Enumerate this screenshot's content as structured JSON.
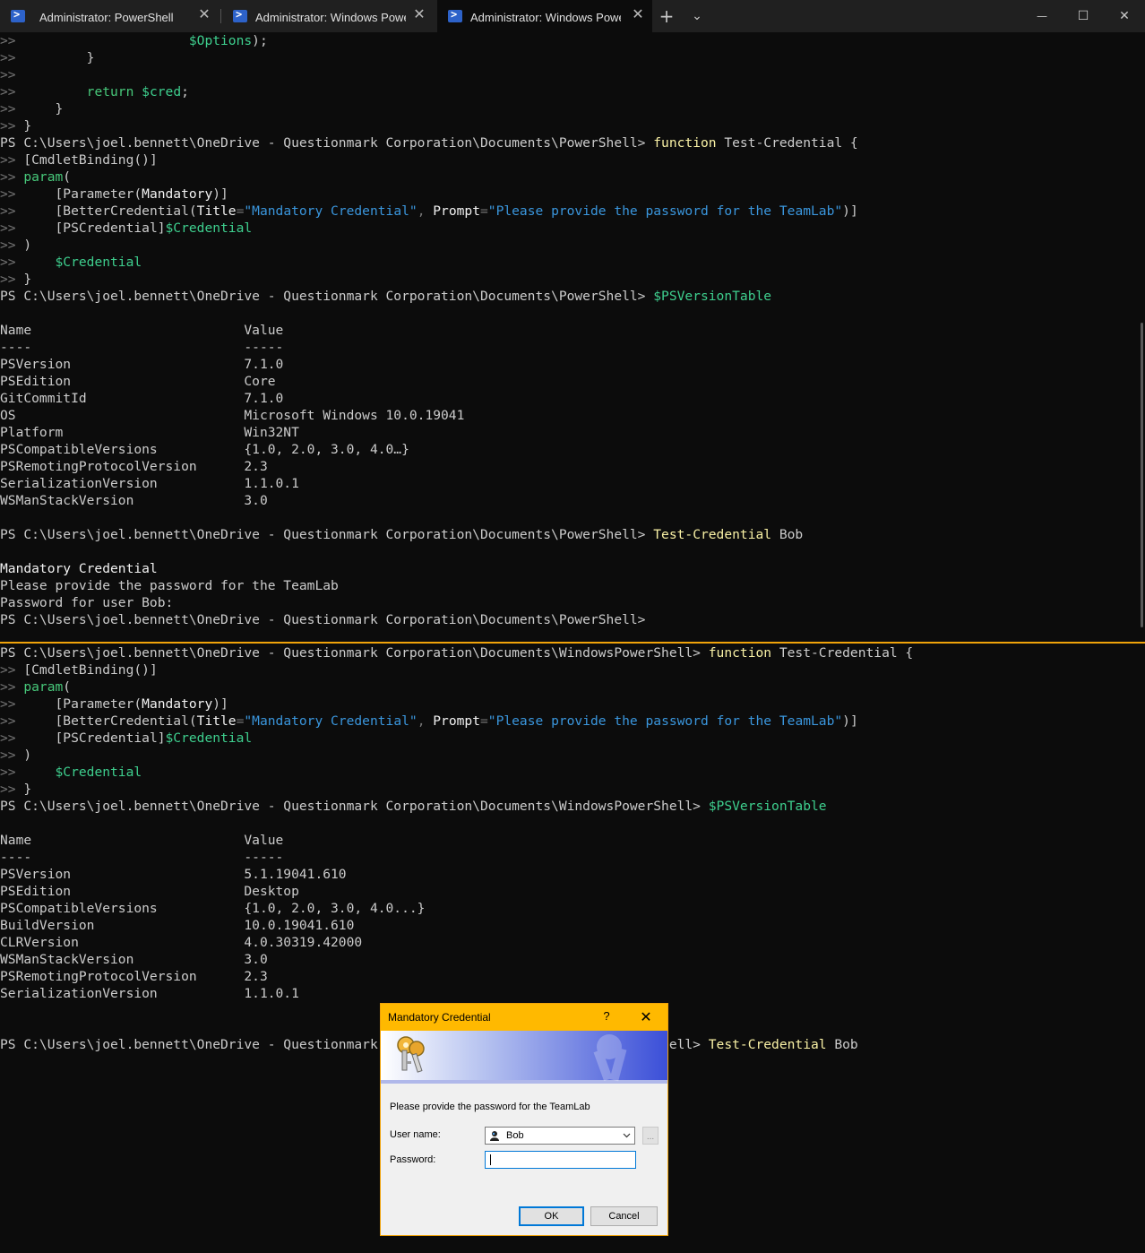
{
  "window": {
    "tabs": [
      {
        "label": "Administrator: PowerShell",
        "active": false
      },
      {
        "label": "Administrator: Windows PowerShell",
        "active": false
      },
      {
        "label": "Administrator: Windows PowerShell",
        "active": true
      }
    ],
    "new_tab_glyph": "+",
    "dropdown_glyph": "⌄",
    "minimize_glyph": "—",
    "maximize_glyph": "☐",
    "close_glyph": "✕",
    "tab_close_glyph": "✕"
  },
  "pane_top": {
    "lines": [
      [
        [
          "c-gry",
          ">> "
        ],
        [
          "c-def",
          "                     "
        ],
        [
          "c-var",
          "$Options"
        ],
        [
          "c-def",
          ");"
        ]
      ],
      [
        [
          "c-gry",
          ">> "
        ],
        [
          "c-def",
          "        }"
        ]
      ],
      [
        [
          "c-gry",
          ">>"
        ]
      ],
      [
        [
          "c-gry",
          ">> "
        ],
        [
          "c-def",
          "        "
        ],
        [
          "c-kw",
          "return"
        ],
        [
          "c-def",
          " "
        ],
        [
          "c-var",
          "$cred"
        ],
        [
          "c-def",
          ";"
        ]
      ],
      [
        [
          "c-gry",
          ">> "
        ],
        [
          "c-def",
          "    }"
        ]
      ],
      [
        [
          "c-gry",
          ">> "
        ],
        [
          "c-def",
          "}"
        ]
      ],
      [
        [
          "c-def",
          "PS C:\\Users\\joel.bennett\\OneDrive - Questionmark Corporation\\Documents\\PowerShell> "
        ],
        [
          "c-cmd",
          "function"
        ],
        [
          "c-def",
          " Test-Credential {"
        ]
      ],
      [
        [
          "c-gry",
          ">> "
        ],
        [
          "c-def",
          "[CmdletBinding()]"
        ]
      ],
      [
        [
          "c-gry",
          ">> "
        ],
        [
          "c-kw",
          "param"
        ],
        [
          "c-def",
          "("
        ]
      ],
      [
        [
          "c-gry",
          ">> "
        ],
        [
          "c-def",
          "    [Parameter("
        ],
        [
          "c-wht",
          "Mandatory"
        ],
        [
          "c-def",
          ")]"
        ]
      ],
      [
        [
          "c-gry",
          ">> "
        ],
        [
          "c-def",
          "    [BetterCredential("
        ],
        [
          "c-wht",
          "Title"
        ],
        [
          "c-gry",
          "="
        ],
        [
          "c-str",
          "\"Mandatory Credential\""
        ],
        [
          "c-gry",
          ", "
        ],
        [
          "c-wht",
          "Prompt"
        ],
        [
          "c-gry",
          "="
        ],
        [
          "c-str",
          "\"Please provide the password for the TeamLab\""
        ],
        [
          "c-def",
          ")]"
        ]
      ],
      [
        [
          "c-gry",
          ">> "
        ],
        [
          "c-def",
          "    [PSCredential]"
        ],
        [
          "c-var",
          "$Credential"
        ]
      ],
      [
        [
          "c-gry",
          ">> "
        ],
        [
          "c-def",
          ")"
        ]
      ],
      [
        [
          "c-gry",
          ">> "
        ],
        [
          "c-def",
          "    "
        ],
        [
          "c-var",
          "$Credential"
        ]
      ],
      [
        [
          "c-gry",
          ">> "
        ],
        [
          "c-def",
          "}"
        ]
      ],
      [
        [
          "c-def",
          "PS C:\\Users\\joel.bennett\\OneDrive - Questionmark Corporation\\Documents\\PowerShell> "
        ],
        [
          "c-var",
          "$PSVersionTable"
        ]
      ],
      [],
      [
        [
          "c-def",
          "Name                           Value"
        ]
      ],
      [
        [
          "c-def",
          "----                           -----"
        ]
      ],
      [
        [
          "c-def",
          "PSVersion                      7.1.0"
        ]
      ],
      [
        [
          "c-def",
          "PSEdition                      Core"
        ]
      ],
      [
        [
          "c-def",
          "GitCommitId                    7.1.0"
        ]
      ],
      [
        [
          "c-def",
          "OS                             Microsoft Windows 10.0.19041"
        ]
      ],
      [
        [
          "c-def",
          "Platform                       Win32NT"
        ]
      ],
      [
        [
          "c-def",
          "PSCompatibleVersions           {1.0, 2.0, 3.0, 4.0…}"
        ]
      ],
      [
        [
          "c-def",
          "PSRemotingProtocolVersion      2.3"
        ]
      ],
      [
        [
          "c-def",
          "SerializationVersion           1.1.0.1"
        ]
      ],
      [
        [
          "c-def",
          "WSManStackVersion              3.0"
        ]
      ],
      [],
      [
        [
          "c-def",
          "PS C:\\Users\\joel.bennett\\OneDrive - Questionmark Corporation\\Documents\\PowerShell> "
        ],
        [
          "c-cmd",
          "Test-Credential"
        ],
        [
          "c-def",
          " Bob"
        ]
      ],
      [],
      [
        [
          "c-bold",
          "Mandatory Credential"
        ]
      ],
      [
        [
          "c-def",
          "Please provide the password for the TeamLab"
        ]
      ],
      [
        [
          "c-def",
          "Password for user Bob:"
        ]
      ],
      [
        [
          "c-def",
          "PS C:\\Users\\joel.bennett\\OneDrive - Questionmark Corporation\\Documents\\PowerShell>"
        ]
      ]
    ]
  },
  "pane_bottom": {
    "lines": [
      [
        [
          "c-def",
          "PS C:\\Users\\joel.bennett\\OneDrive - Questionmark Corporation\\Documents\\WindowsPowerShell> "
        ],
        [
          "c-cmd",
          "function"
        ],
        [
          "c-def",
          " Test-Credential {"
        ]
      ],
      [
        [
          "c-gry",
          ">> "
        ],
        [
          "c-def",
          "[CmdletBinding()]"
        ]
      ],
      [
        [
          "c-gry",
          ">> "
        ],
        [
          "c-kw",
          "param"
        ],
        [
          "c-def",
          "("
        ]
      ],
      [
        [
          "c-gry",
          ">> "
        ],
        [
          "c-def",
          "    [Parameter("
        ],
        [
          "c-wht",
          "Mandatory"
        ],
        [
          "c-def",
          ")]"
        ]
      ],
      [
        [
          "c-gry",
          ">> "
        ],
        [
          "c-def",
          "    [BetterCredential("
        ],
        [
          "c-wht",
          "Title"
        ],
        [
          "c-gry",
          "="
        ],
        [
          "c-str",
          "\"Mandatory Credential\""
        ],
        [
          "c-gry",
          ", "
        ],
        [
          "c-wht",
          "Prompt"
        ],
        [
          "c-gry",
          "="
        ],
        [
          "c-str",
          "\"Please provide the password for the TeamLab\""
        ],
        [
          "c-def",
          ")]"
        ]
      ],
      [
        [
          "c-gry",
          ">> "
        ],
        [
          "c-def",
          "    [PSCredential]"
        ],
        [
          "c-var",
          "$Credential"
        ]
      ],
      [
        [
          "c-gry",
          ">> "
        ],
        [
          "c-def",
          ")"
        ]
      ],
      [
        [
          "c-gry",
          ">> "
        ],
        [
          "c-def",
          "    "
        ],
        [
          "c-var",
          "$Credential"
        ]
      ],
      [
        [
          "c-gry",
          ">> "
        ],
        [
          "c-def",
          "}"
        ]
      ],
      [
        [
          "c-def",
          "PS C:\\Users\\joel.bennett\\OneDrive - Questionmark Corporation\\Documents\\WindowsPowerShell> "
        ],
        [
          "c-var",
          "$PSVersionTable"
        ]
      ],
      [],
      [
        [
          "c-def",
          "Name                           Value"
        ]
      ],
      [
        [
          "c-def",
          "----                           -----"
        ]
      ],
      [
        [
          "c-def",
          "PSVersion                      5.1.19041.610"
        ]
      ],
      [
        [
          "c-def",
          "PSEdition                      Desktop"
        ]
      ],
      [
        [
          "c-def",
          "PSCompatibleVersions           {1.0, 2.0, 3.0, 4.0...}"
        ]
      ],
      [
        [
          "c-def",
          "BuildVersion                   10.0.19041.610"
        ]
      ],
      [
        [
          "c-def",
          "CLRVersion                     4.0.30319.42000"
        ]
      ],
      [
        [
          "c-def",
          "WSManStackVersion              3.0"
        ]
      ],
      [
        [
          "c-def",
          "PSRemotingProtocolVersion      2.3"
        ]
      ],
      [
        [
          "c-def",
          "SerializationVersion           1.1.0.1"
        ]
      ],
      [],
      [],
      [
        [
          "c-def",
          "PS C:\\Users\\joel.bennett\\OneDrive - Questionmark Corporation\\Documents\\WindowsPowerShell> "
        ],
        [
          "c-cmd",
          "Test-Credential"
        ],
        [
          "c-def",
          " Bob"
        ]
      ]
    ]
  },
  "dialog": {
    "title": "Mandatory Credential",
    "help_glyph": "?",
    "close_glyph": "✕",
    "message": "Please provide the password for the TeamLab",
    "username_label": "User name:",
    "username_value": "Bob",
    "browse_label": "...",
    "password_label": "Password:",
    "ok_label": "OK",
    "cancel_label": "Cancel"
  },
  "colors": {
    "terminal_bg": "#0c0c0c",
    "tabbar_bg": "#202020",
    "pane_divider": "#f0a30a",
    "dialog_titlebar": "#ffb900",
    "focus_blue": "#0078d7"
  }
}
